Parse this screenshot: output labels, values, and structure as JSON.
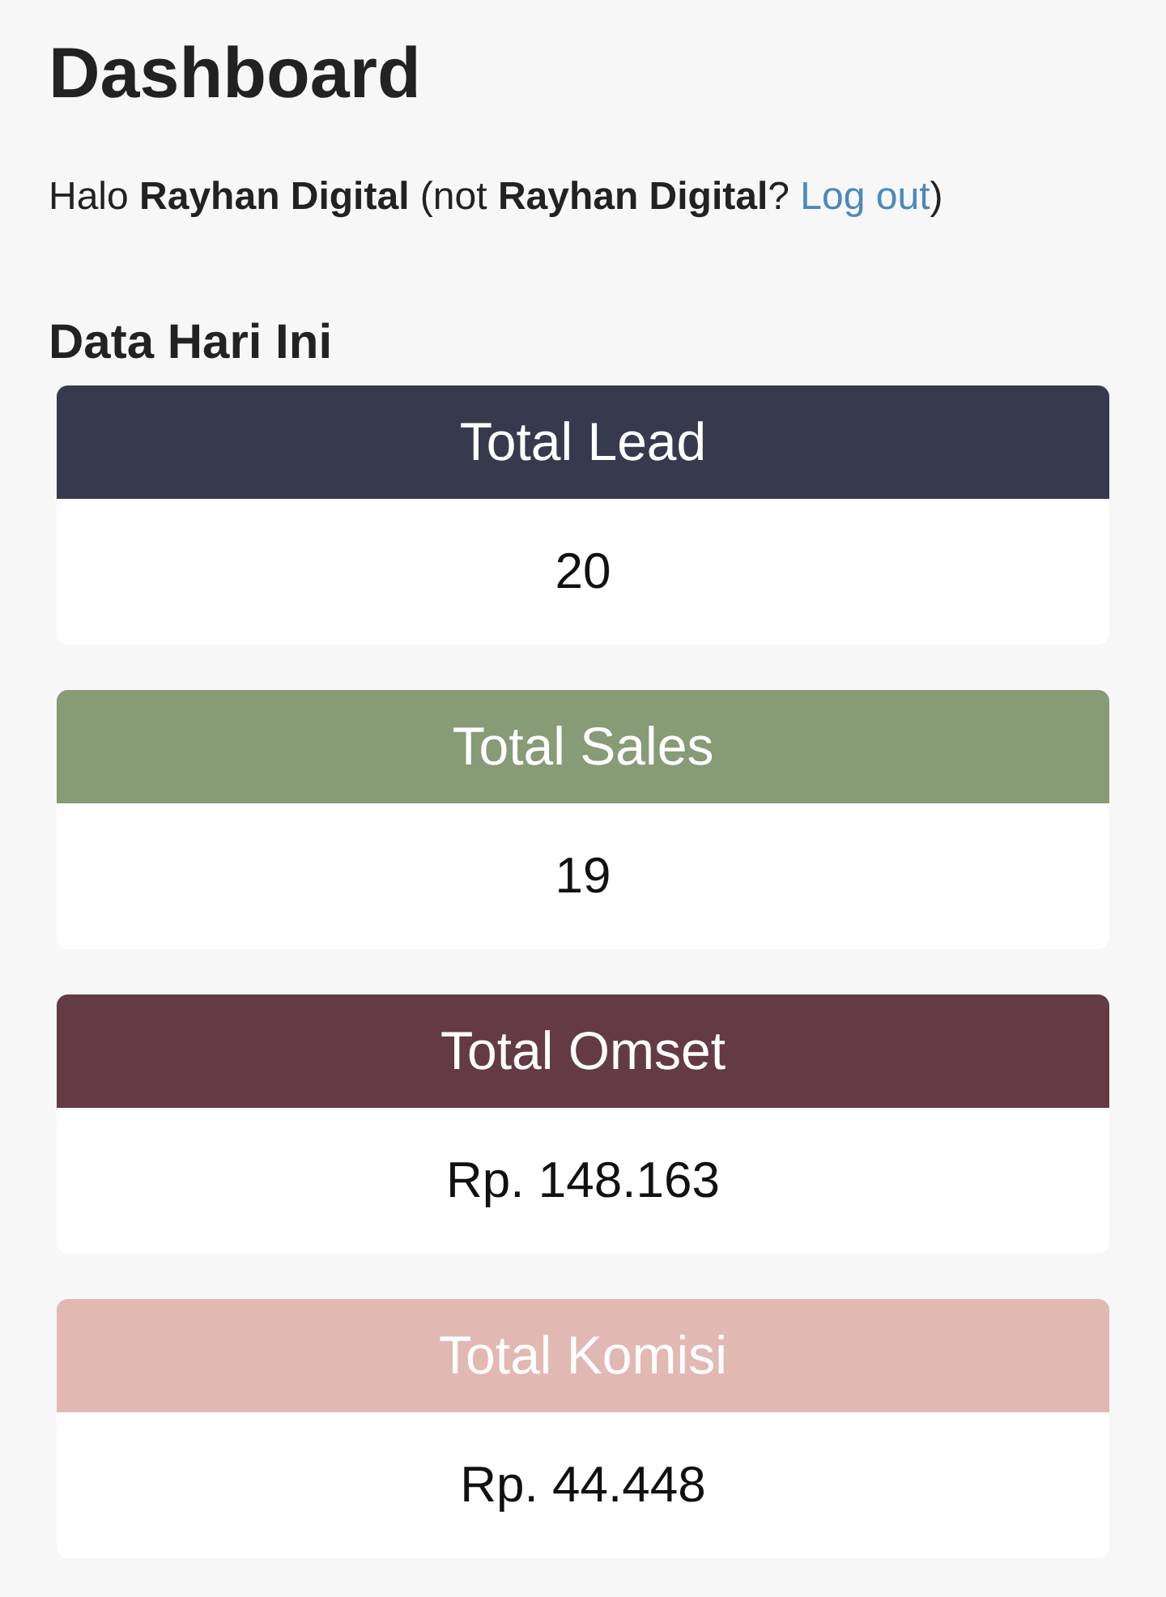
{
  "page": {
    "title": "Dashboard"
  },
  "greeting": {
    "text": "Halo **Rayhan Digital** (not **Rayhan Digital**?",
    "link": "Log out",
    "text_after": ")"
  },
  "section": {
    "title": "Data Hari Ini"
  },
  "cards": [
    {
      "title": "Total Lead",
      "value": "20",
      "color": "#373a4d"
    },
    {
      "title": "Total Sales",
      "value": "19",
      "color": "#879b76"
    },
    {
      "title": "Total Omset",
      "value": "Rp. 148.163",
      "color": "#643a45"
    },
    {
      "title": "Total Komisi",
      "value": "Rp. 44.448",
      "color": "#e2b8b3"
    }
  ]
}
